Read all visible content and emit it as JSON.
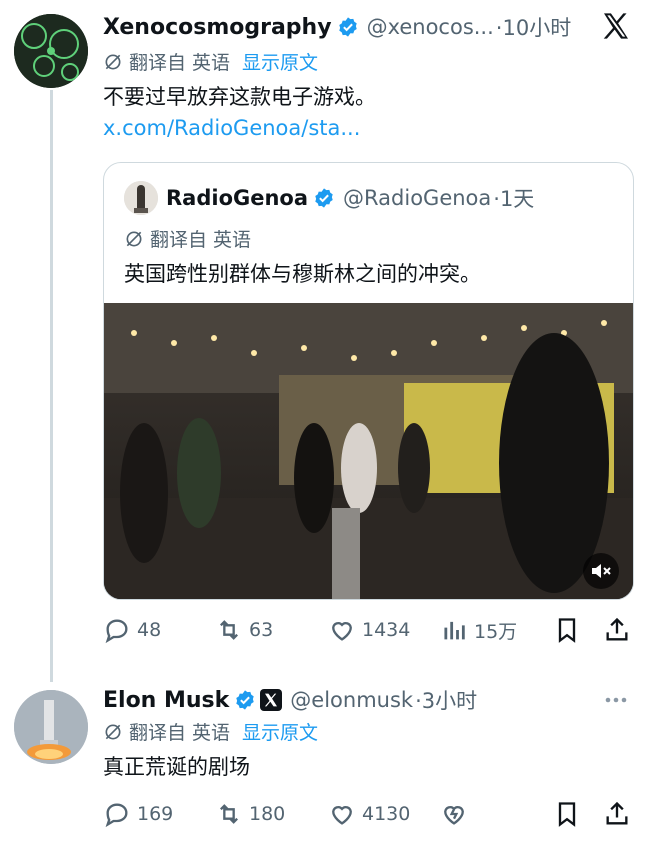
{
  "tweet1": {
    "author": "Xenocosmography",
    "handle": "@xenocos...",
    "time": "·10小时",
    "translate_label": "翻译自",
    "language": "英语",
    "show_original": "显示原文",
    "text": "不要过早放弃这款电子游戏。",
    "link_text": "x.com/RadioGenoa/sta...",
    "stats": {
      "replies": "48",
      "reposts": "63",
      "likes": "1434",
      "views": "15万"
    }
  },
  "quote": {
    "author": "RadioGenoa",
    "handle": "@RadioGenoa",
    "time": "·1天",
    "translate_label": "翻译自",
    "language": "英语",
    "text": "英国跨性别群体与穆斯林之间的冲突。"
  },
  "tweet2": {
    "author": "Elon Musk",
    "handle": "@elonmusk",
    "time": "·3小时",
    "translate_label": "翻译自",
    "language": "英语",
    "show_original": "显示原文",
    "text": "真正荒诞的剧场",
    "stats": {
      "replies": "169",
      "reposts": "180",
      "likes": "4130"
    }
  },
  "colors": {
    "accent": "#1d9bf0",
    "secondary_text": "#536471",
    "border": "#cfd9de"
  }
}
